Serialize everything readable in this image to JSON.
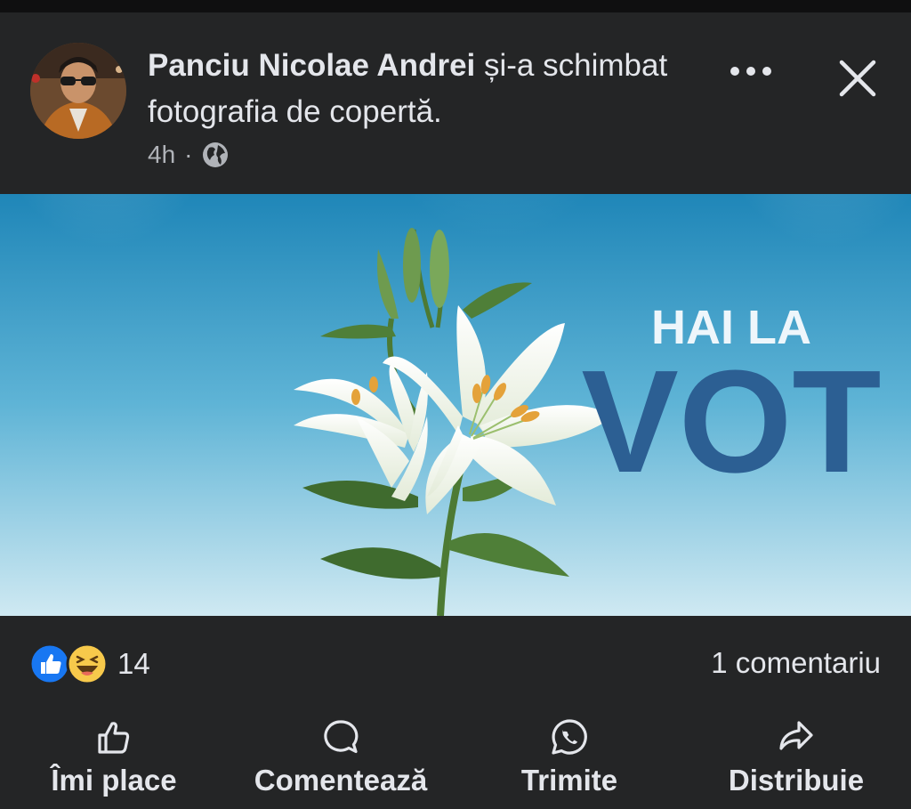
{
  "post": {
    "author": "Panciu Nicolae Andrei",
    "action_text": " și-a schimbat fotografia de copertă.",
    "time": "4h",
    "separator": "·",
    "audience_icon": "globe-icon"
  },
  "cover_image": {
    "headline_small": "HAI LA",
    "headline_large": "VOT"
  },
  "stats": {
    "reaction_icons": [
      "like-icon",
      "haha-icon"
    ],
    "reaction_count": "14",
    "comments": "1 comentariu"
  },
  "actions": [
    {
      "label": "Îmi place",
      "icon": "thumbs-up-icon"
    },
    {
      "label": "Comentează",
      "icon": "comment-icon"
    },
    {
      "label": "Trimite",
      "icon": "whatsapp-icon"
    },
    {
      "label": "Distribuie",
      "icon": "share-icon"
    }
  ],
  "colors": {
    "background": "#242526",
    "text": "#e4e6eb",
    "muted": "#b0b3b8",
    "like_blue": "#1877f2",
    "haha_yellow": "#f7c94b",
    "vot_blue": "#2c5f93"
  }
}
